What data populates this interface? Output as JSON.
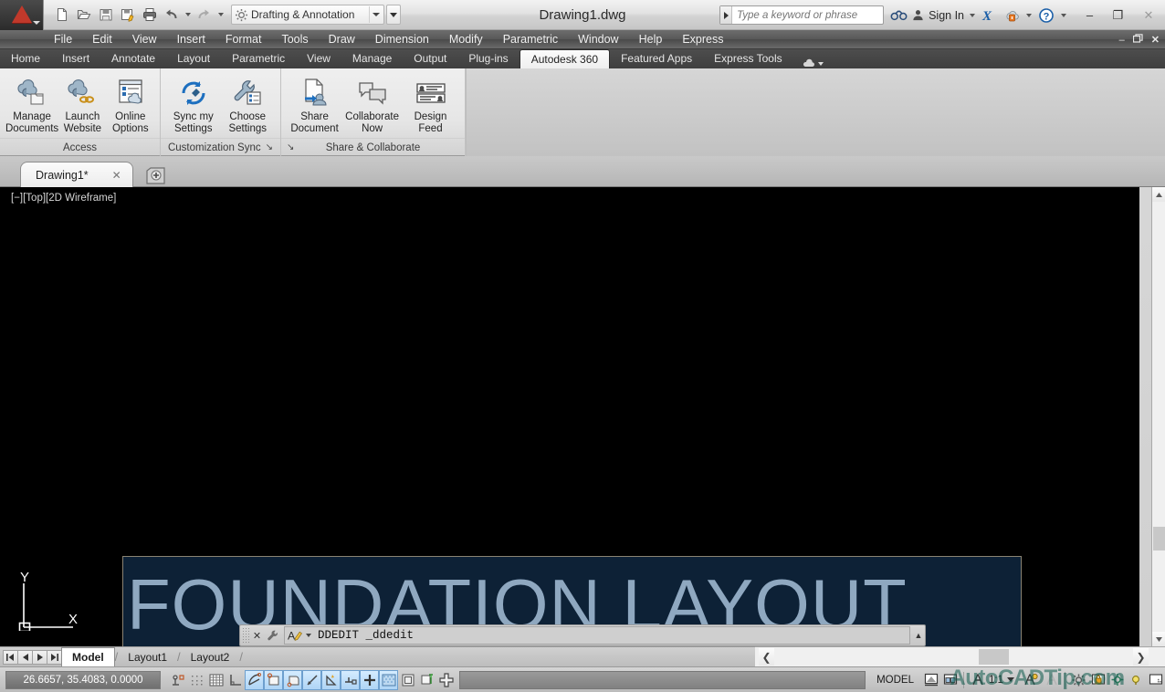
{
  "titlebar": {
    "app_icon": "autocad-logo",
    "quick_access": [
      {
        "name": "new-file",
        "icon": "page-icon"
      },
      {
        "name": "open-file",
        "icon": "folder-icon"
      },
      {
        "name": "save-file",
        "icon": "floppy-icon"
      },
      {
        "name": "save-as",
        "icon": "floppy-pencil-icon"
      },
      {
        "name": "plot",
        "icon": "printer-icon"
      },
      {
        "name": "undo",
        "icon": "undo-arrow-icon"
      },
      {
        "name": "redo",
        "icon": "redo-arrow-icon"
      }
    ],
    "workspace": "Drafting & Annotation",
    "document_title": "Drawing1.dwg",
    "search_placeholder": "Type a keyword or phrase",
    "search_value": "",
    "sign_in": "Sign In",
    "window_buttons": {
      "minimize": "–",
      "maximize": "❐",
      "close": "✕"
    }
  },
  "menubar": {
    "items": [
      "File",
      "Edit",
      "View",
      "Insert",
      "Format",
      "Tools",
      "Draw",
      "Dimension",
      "Modify",
      "Parametric",
      "Window",
      "Help",
      "Express"
    ],
    "doc_buttons": {
      "minimize": "–",
      "restore": "❐",
      "close": "✕"
    }
  },
  "ribbon_tabs": {
    "items": [
      "Home",
      "Insert",
      "Annotate",
      "Layout",
      "Parametric",
      "View",
      "Manage",
      "Output",
      "Plug-ins",
      "Autodesk 360",
      "Featured Apps",
      "Express Tools"
    ],
    "active": "Autodesk 360"
  },
  "ribbon": {
    "panels": [
      {
        "title": "Access",
        "has_expander": false,
        "buttons": [
          {
            "label_line1": "Manage",
            "label_line2": "Documents",
            "icon": "cloud-documents-icon"
          },
          {
            "label_line1": "Launch",
            "label_line2": "Website",
            "icon": "cloud-link-icon"
          },
          {
            "label_line1": "Online",
            "label_line2": "Options",
            "icon": "cloud-options-icon"
          }
        ]
      },
      {
        "title": "Customization Sync",
        "has_expander": true,
        "buttons": [
          {
            "label_line1": "Sync my",
            "label_line2": "Settings",
            "icon": "sync-arrows-icon"
          },
          {
            "label_line1": "Choose",
            "label_line2": "Settings",
            "icon": "wrench-settings-icon"
          }
        ]
      },
      {
        "title": "Share & Collaborate",
        "has_expander": true,
        "buttons": [
          {
            "label_line1": "Share",
            "label_line2": "Document",
            "icon": "share-document-icon"
          },
          {
            "label_line1": "Collaborate",
            "label_line2": "Now",
            "icon": "speech-bubbles-icon"
          },
          {
            "label_line1": "Design Feed",
            "label_line2": "",
            "icon": "design-feed-icon"
          }
        ]
      }
    ]
  },
  "file_tabs": {
    "tabs": [
      {
        "label": "Drawing1*",
        "close": "✕",
        "active": true
      }
    ],
    "new_tab_icon": "plus-tab-icon"
  },
  "canvas": {
    "viewport_label": "[−][Top][2D Wireframe]",
    "background_color": "#000000",
    "text_editor": {
      "content": "FOUNDATION LAYOUT",
      "background_color": "#0d2136",
      "text_color": "#8fa8c0",
      "border_color": "#8a8372"
    },
    "ucs_icon": {
      "x_label": "X",
      "y_label": "Y"
    }
  },
  "command_line": {
    "close_label": "✕",
    "prompt_icon": "pen-a-icon",
    "text": "DDEDIT  _ddedit",
    "expand_icon": "▲"
  },
  "layout_tabs": {
    "nav": [
      "❙◀",
      "◀",
      "▶",
      "▶❙"
    ],
    "tabs": [
      {
        "label": "Model",
        "active": true
      },
      {
        "label": "Layout1",
        "active": false
      },
      {
        "label": "Layout2",
        "active": false
      }
    ]
  },
  "status_bar": {
    "coordinates": "26.6657, 35.4083, 0.0000",
    "toggles": [
      {
        "name": "infer-constraints",
        "on": false
      },
      {
        "name": "snap-mode",
        "on": false
      },
      {
        "name": "grid-display",
        "on": false
      },
      {
        "name": "ortho-mode",
        "on": false
      },
      {
        "name": "polar-tracking",
        "on": true
      },
      {
        "name": "object-snap",
        "on": true
      },
      {
        "name": "3d-object-snap",
        "on": true
      },
      {
        "name": "object-snap-tracking",
        "on": true
      },
      {
        "name": "allow-ucs",
        "on": true
      },
      {
        "name": "dynamic-ucs",
        "on": true
      },
      {
        "name": "dynamic-input",
        "on": true
      },
      {
        "name": "lineweight",
        "on": true
      },
      {
        "name": "transparency",
        "on": false
      },
      {
        "name": "quick-properties",
        "on": false
      },
      {
        "name": "selection-cycling",
        "on": false
      }
    ],
    "space_label": "MODEL",
    "annotation_scale": "1:1",
    "right_icons": [
      {
        "name": "quick-view-layouts-icon"
      },
      {
        "name": "quick-view-drawings-icon"
      },
      {
        "name": "annotation-scale-icon"
      },
      {
        "name": "annotation-visibility-icon"
      },
      {
        "name": "auto-scale-icon"
      },
      {
        "name": "workspace-switching-icon"
      },
      {
        "name": "toolbar-lock-icon"
      },
      {
        "name": "hardware-acceleration-icon"
      },
      {
        "name": "isolate-objects-icon"
      },
      {
        "name": "clean-screen-icon"
      }
    ]
  },
  "watermark": {
    "text": "AutoCADTip.com"
  }
}
